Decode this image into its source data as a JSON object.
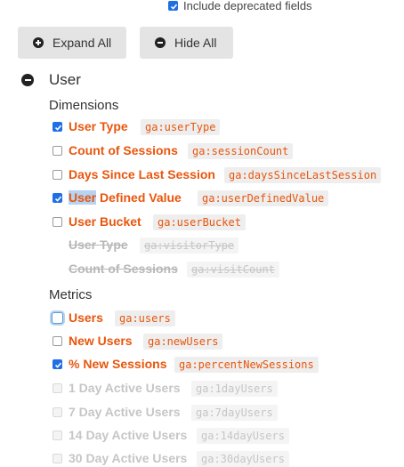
{
  "include_deprecated": {
    "label": "Include deprecated fields",
    "checked": true
  },
  "toolbar": {
    "expand_label": "Expand All",
    "hide_label": "Hide All"
  },
  "section": {
    "title": "User",
    "dimensions_heading": "Dimensions",
    "metrics_heading": "Metrics",
    "dimensions": [
      {
        "label": "User Type",
        "code": "ga:userType",
        "checked": true,
        "state": "normal"
      },
      {
        "label": "Count of Sessions",
        "code": "ga:sessionCount",
        "checked": false,
        "state": "normal"
      },
      {
        "label": "Days Since Last Session",
        "code": "ga:daysSinceLastSession",
        "checked": false,
        "state": "normal"
      },
      {
        "label_highlight": "User",
        "label_rest": " Defined Value",
        "code": "ga:userDefinedValue",
        "checked": true,
        "state": "normal"
      },
      {
        "label": "User Bucket",
        "code": "ga:userBucket",
        "checked": false,
        "state": "normal"
      },
      {
        "label": "User Type",
        "code": "ga:visitorType",
        "state": "deprecated"
      },
      {
        "label": "Count of Sessions",
        "code": "ga:visitCount",
        "state": "deprecated"
      }
    ],
    "metrics": [
      {
        "label": "Users",
        "code": "ga:users",
        "checked": false,
        "state": "focused"
      },
      {
        "label": "New Users",
        "code": "ga:newUsers",
        "checked": false,
        "state": "normal"
      },
      {
        "label": "% New Sessions",
        "code": "ga:percentNewSessions",
        "checked": true,
        "state": "normal"
      },
      {
        "label": "1 Day Active Users",
        "code": "ga:1dayUsers",
        "checked": false,
        "state": "disabled"
      },
      {
        "label": "7 Day Active Users",
        "code": "ga:7dayUsers",
        "checked": false,
        "state": "disabled"
      },
      {
        "label": "14 Day Active Users",
        "code": "ga:14dayUsers",
        "checked": false,
        "state": "disabled"
      },
      {
        "label": "30 Day Active Users",
        "code": "ga:30dayUsers",
        "checked": false,
        "state": "disabled"
      }
    ]
  }
}
